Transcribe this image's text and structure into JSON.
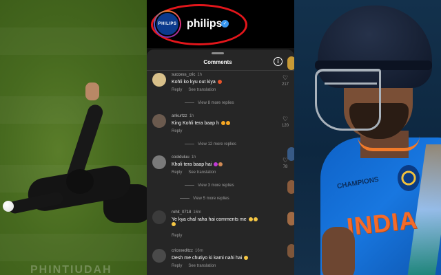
{
  "left_photo": {
    "watermark": "PHINTIUDAH"
  },
  "profile": {
    "avatar_text": "PHILIPS",
    "name": "philips",
    "verified_icon": "verified-badge-icon",
    "highlight_color": "#e3161b"
  },
  "sheet": {
    "title": "Comments",
    "info_icon": "i"
  },
  "comments": [
    {
      "user": "success_cric",
      "time": "1h",
      "text": "Kohli ko kyu out kiya",
      "reply": "Reply",
      "translate": "See translation",
      "likes": "217",
      "view_replies": "View 8 more replies"
    },
    {
      "user": "ankurtzz",
      "time": "1h",
      "text": "King Kohli tera baap h",
      "reply": "Reply",
      "translate": "",
      "likes": "120",
      "view_replies": "View 12 more replies"
    },
    {
      "user": "coolduluu",
      "time": "1h",
      "text": "Kholi tera baap hai",
      "reply": "Reply",
      "translate": "See translation",
      "likes": "78",
      "view_replies": "View 3 more replies"
    },
    {
      "user": "",
      "time": "",
      "text": "",
      "reply": "",
      "translate": "",
      "likes": "",
      "view_replies": "View 5 more replies"
    },
    {
      "user": "rohit_0718",
      "time": "16m",
      "text": "Ye kya chal raha hai comments me",
      "reply": "Reply",
      "translate": "",
      "likes": "",
      "view_replies": ""
    },
    {
      "user": "cricxxeditzz",
      "time": "16m",
      "text": "Desh me chutiyo ki kami nahi hai",
      "reply": "Reply",
      "translate": "See translation",
      "likes": "",
      "view_replies": ""
    }
  ],
  "right_photo": {
    "jersey_text": "INDIA",
    "badge_text": "CHAMPIONS"
  },
  "colors": {
    "sheet_bg": "#262626",
    "text_primary": "#ffffff",
    "text_muted": "#9a9a9a",
    "jersey_blue": "#1877e0",
    "jersey_orange": "#f36b2b"
  }
}
